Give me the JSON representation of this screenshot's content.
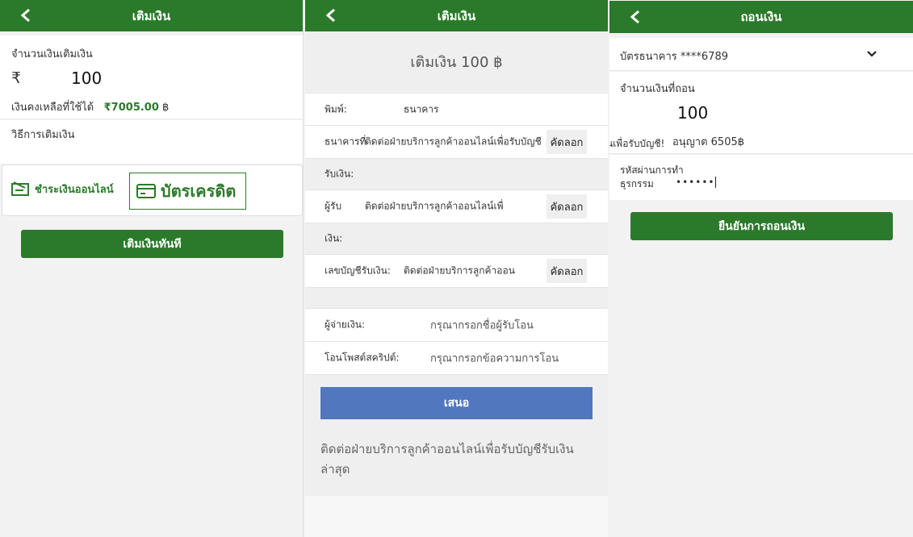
{
  "panel1": {
    "title": "เติมเงิน",
    "amount_label": "จำนวนเงินเติมเงิน",
    "currency_symbol": "₹",
    "amount_value": "100",
    "balance_label": "เงินคงเหลือที่ใช้ได้",
    "balance_value": "₹7005.00",
    "balance_suffix": " ฿",
    "method_label": "วิธีการเติมเงิน",
    "pay_online_label": "ชำระเงินออนไลน์",
    "pay_card_label": "บัตรเครดิต",
    "submit_label": "เติมเงินทันที"
  },
  "panel2": {
    "title": "เติมเงิน",
    "amount_heading": "เติมเงิน 100 ฿",
    "type_label": "พิมพ์:",
    "type_value": "ธนาคาร",
    "bank_label": "ธนาคารที่",
    "bank_value": "ติดต่อฝ่ายบริการลูกค้าออนไลน์เพื่อรับบัญชี!",
    "copy_label": "คัดลอก",
    "receive_section": "รับเงิน:",
    "receiver_label": "ผู้รับ",
    "receiver_value": "ติดต่อฝ่ายบริการลูกค้าออนไลน์เพื่",
    "money_section": "เงิน:",
    "account_label": "เลขบัญชีรับเงิน:",
    "account_value": "ติดต่อฝ่ายบริการลูกค้าออน",
    "payer_label": "ผู้จ่ายเงิน:",
    "payer_placeholder": "กรุณากรอกชื่อผู้รับโอน",
    "postscript_label": "โอนโพสต์สคริปต์:",
    "postscript_placeholder": "กรุณากรอกข้อความการโอน",
    "submit_label": "เสนอ",
    "note": "ติดต่อฝ่ายบริการลูกค้าออนไลน์เพื่อรับบัญชีรับเงินล่าสุด"
  },
  "panel3": {
    "title": "ถอนเงิน",
    "bank_card": "บัตรธนาคาร  ****6789",
    "amount_label": "จำนวนเงินที่ถอน",
    "amount_value": "100",
    "overflow_text": "นเพื่อรับบัญชี!",
    "limit_text": "อนุญาต 6505฿",
    "password_label": "รหัสผ่านการทำธุรกรรม",
    "password_value": "••••••",
    "submit_label": "ยืนยันการถอนเงิน"
  },
  "colors": {
    "header_green": "#2b7a2b",
    "submit_blue": "#5178bf"
  }
}
